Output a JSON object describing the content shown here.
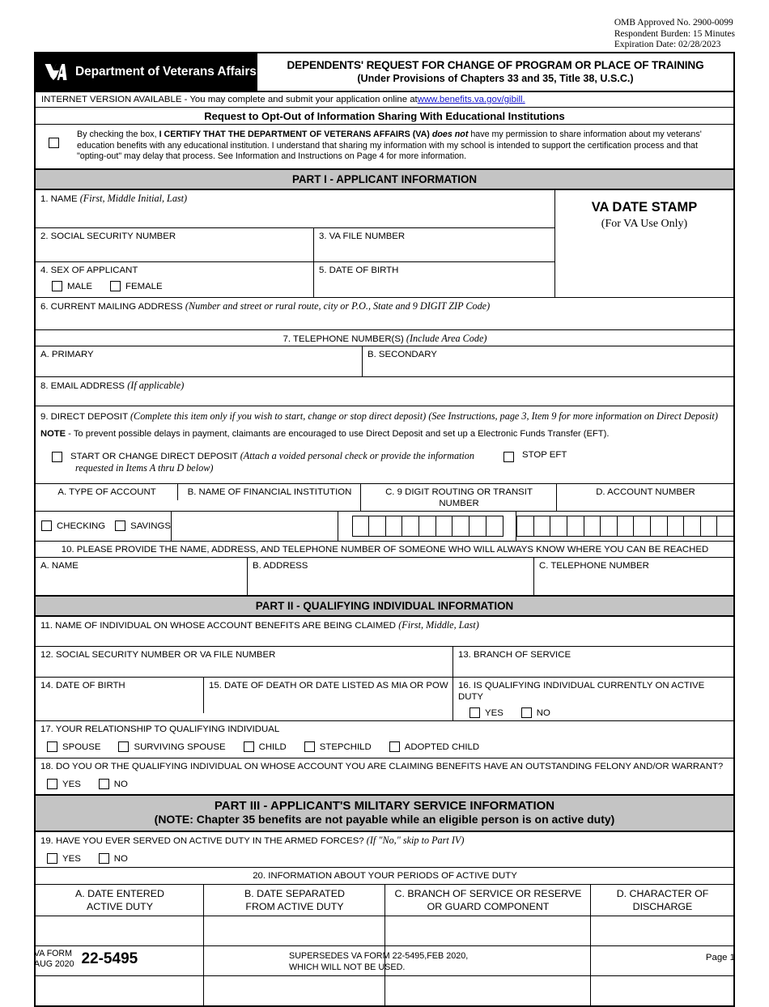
{
  "header": {
    "omb_line1": "OMB  Approved No. 2900-0099",
    "omb_line2": "Respondent Burden: 15 Minutes",
    "omb_line3": "Expiration Date:  02/28/2023"
  },
  "title": {
    "department": "Department of Veterans Affairs",
    "form_title": "DEPENDENTS' REQUEST FOR CHANGE OF PROGRAM OR PLACE OF TRAINING",
    "form_subtitle": "(Under Provisions of Chapters 33 and 35, Title 38, U.S.C.)"
  },
  "internet": {
    "text": "INTERNET VERSION AVAILABLE -  You may complete and submit your application online at ",
    "url": "www.benefits.va.gov/gibill."
  },
  "optout": {
    "heading": "Request to Opt-Out of Information Sharing With Educational Institutions",
    "line1_a": "By checking the box, ",
    "line1_b": "I CERTIFY THAT THE DEPARTMENT OF VETERANS AFFAIRS (VA) ",
    "line1_c": "does not",
    "line1_d": " have my permission to share information about my veterans'",
    "line2": "education benefits with any educational institution. I understand that sharing my information with my school is intended to support the certification process and that",
    "line3": "\"opting-out\" may delay that process. See Information and Instructions on Page 4 for more information."
  },
  "part1": {
    "bar": "PART I - APPLICANT INFORMATION",
    "item1_label": "1. NAME",
    "item1_hint": "(First, Middle Initial, Last)",
    "stamp_title": "VA DATE STAMP",
    "stamp_sub": "(For VA Use Only)",
    "item2_label": "2. SOCIAL SECURITY NUMBER",
    "item3_label": "3. VA FILE NUMBER",
    "item4_label": "4. SEX OF APPLICANT",
    "item4_options": [
      "MALE",
      "FEMALE"
    ],
    "item5_label": "5. DATE OF BIRTH",
    "item6_label": "6. CURRENT MAILING ADDRESS",
    "item6_hint": "(Number and street or rural route, city or P.O., State and 9 DIGIT ZIP Code)",
    "item7_label": "7. TELEPHONE NUMBER(S)",
    "item7_hint": "(Include Area Code)",
    "item7a_label": "A. PRIMARY",
    "item7b_label": "B. SECONDARY",
    "item8_label": "8. EMAIL ADDRESS",
    "item8_hint": "(If applicable)",
    "item9_label": "9. DIRECT DEPOSIT",
    "item9_hint1": "(Complete this item only if you wish to start, change or stop direct deposit)",
    "item9_hint2": "(See Instructions, page 3, Item 9 for more information on Direct Deposit)",
    "item9_note_bold": "NOTE",
    "item9_note": " - To prevent possible delays in payment, claimants are encouraged to use Direct Deposit and set up a Electronic Funds Transfer (EFT).",
    "item9_start_label": "START OR CHANGE DIRECT DEPOSIT",
    "item9_start_hint1": "(Attach a voided personal check or provide the information",
    "item9_start_hint2": "requested in Items A thru D below)",
    "item9_stop_label": "STOP EFT",
    "item9a_label": "A. TYPE OF ACCOUNT",
    "item9a_options": [
      "CHECKING",
      "SAVINGS"
    ],
    "item9b_label": "B. NAME OF FINANCIAL INSTITUTION",
    "item9c_label": "C. 9 DIGIT ROUTING OR TRANSIT NUMBER",
    "item9c_cells": 9,
    "item9d_label": "D. ACCOUNT NUMBER",
    "item9d_cells": 13,
    "item10_label": "10. PLEASE PROVIDE THE NAME, ADDRESS, AND TELEPHONE NUMBER OF SOMEONE WHO WILL ALWAYS KNOW WHERE YOU CAN BE REACHED",
    "item10a_label": "A. NAME",
    "item10b_label": "B. ADDRESS",
    "item10c_label": "C. TELEPHONE NUMBER"
  },
  "part2": {
    "bar": "PART II - QUALIFYING INDIVIDUAL INFORMATION",
    "item11_label": "11. NAME OF INDIVIDUAL ON WHOSE ACCOUNT BENEFITS ARE BEING CLAIMED",
    "item11_hint": "(First, Middle, Last)",
    "item12_label": "12. SOCIAL SECURITY NUMBER OR VA FILE NUMBER",
    "item13_label": "13. BRANCH OF SERVICE",
    "item14_label": "14. DATE OF BIRTH",
    "item15_label": "15. DATE OF DEATH OR DATE LISTED AS MIA OR POW",
    "item16_label": "16. IS QUALIFYING INDIVIDUAL CURRENTLY ON ACTIVE DUTY",
    "item16_options": [
      "YES",
      "NO"
    ],
    "item17_label": "17. YOUR RELATIONSHIP TO QUALIFYING INDIVIDUAL",
    "item17_options": [
      "SPOUSE",
      "SURVIVING SPOUSE",
      "CHILD",
      "STEPCHILD",
      "ADOPTED CHILD"
    ],
    "item18_label": "18. DO YOU OR THE QUALIFYING INDIVIDUAL ON WHOSE ACCOUNT YOU ARE CLAIMING BENEFITS HAVE AN OUTSTANDING FELONY AND/OR WARRANT?",
    "item18_options": [
      "YES",
      "NO"
    ]
  },
  "part3": {
    "bar_line1": "PART III - APPLICANT'S MILITARY SERVICE INFORMATION",
    "bar_line2": "(NOTE: Chapter 35 benefits are not payable while an eligible person is on active duty)",
    "item19_label": "19. HAVE YOU EVER SERVED ON ACTIVE DUTY IN THE ARMED FORCES?",
    "item19_hint": "(If \"No,\" skip to Part IV)",
    "item19_options": [
      "YES",
      "NO"
    ],
    "item20_label": "20. INFORMATION ABOUT YOUR PERIODS OF ACTIVE DUTY",
    "item20_columns": [
      {
        "line1": "A. DATE ENTERED",
        "line2": "ACTIVE DUTY"
      },
      {
        "line1": "B. DATE SEPARATED",
        "line2": "FROM ACTIVE DUTY"
      },
      {
        "line1": "C. BRANCH OF SERVICE OR RESERVE",
        "line2": "OR GUARD COMPONENT"
      },
      {
        "line1": "D. CHARACTER OF",
        "line2": "DISCHARGE"
      }
    ],
    "item20_rows": 3
  },
  "footer": {
    "va_form_line1": "VA FORM",
    "va_form_line2": "AUG 2020",
    "form_number": "22-5495",
    "supersedes_line1": "SUPERSEDES VA FORM 22-5495,FEB 2020,",
    "supersedes_line2": "WHICH WILL NOT BE USED.",
    "page": "Page 1"
  },
  "colors": {
    "section_bar": "#c4c4c4",
    "link": "#1111cc",
    "rule": "#000000"
  }
}
